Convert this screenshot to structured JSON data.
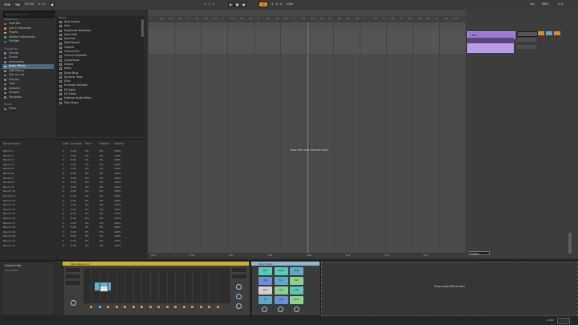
{
  "topbar": {
    "items": [
      "Link",
      "Tap",
      "Key",
      "MIDI"
    ],
    "bpm": "120.00",
    "signature": "4 / 4",
    "position": "1 . 1 . 1",
    "end": "4 . 0 . 0",
    "quantize": "1 Bar",
    "right_items": [
      "Key",
      "MIDI",
      "0 %"
    ]
  },
  "browser": {
    "search_placeholder": "Search (Cmd + F)",
    "collections_head": "Collections",
    "collections": [
      {
        "label": "Favorites",
        "color": "#d85050"
      },
      {
        "label": "Live 12 Recorded",
        "color": "#e08a30"
      },
      {
        "label": "Plugins",
        "color": "#d8c040"
      },
      {
        "label": "Ableton Instruments",
        "color": "#40b060"
      },
      {
        "label": "Untitled",
        "color": "#4080d0"
      }
    ],
    "categories_head": "Categories",
    "categories": [
      "Sounds",
      "Drums",
      "Instruments",
      "Audio Effects",
      "MIDI Effects",
      "Max for Live",
      "Plug-Ins",
      "Clips",
      "Samples",
      "Grooves",
      "Templates"
    ],
    "selected_category": "Audio Effects",
    "places_head": "Places",
    "places": [
      "Packs"
    ],
    "files_head": "Name",
    "files": [
      "Amp Analog",
      "Auto",
      "Amplitude Modulator",
      "Auto Filter",
      "Auto Pan",
      "Beat Repeat",
      "Cabinet",
      "Channel EQ",
      "Chorus-Ensemble",
      "Compressor",
      "Corpus",
      "Delay",
      "Drum Buss",
      "Dynamic Tube",
      "Echo",
      "Envelope Follower",
      "EQ Eight",
      "EQ Three",
      "External Audio Effect",
      "Filter Delay"
    ]
  },
  "rectable": {
    "headers": [
      "Record Name",
      "Slots",
      "Duration",
      "Pitch",
      "Position",
      "Velocity"
    ],
    "rows": [
      "Record 1",
      "Record 2",
      "Record 3",
      "Record 4",
      "Record 5",
      "Record 6",
      "Record 7",
      "Record 8",
      "Record 9",
      "Record 10",
      "Record 11",
      "Record 12",
      "Record 13",
      "Record 14",
      "Record 15",
      "Record 16",
      "Record 17",
      "Record 18",
      "Record 19",
      "Record 20",
      "Record 21",
      "Record 22"
    ],
    "cell_slots": "S",
    "cell_duration": "0:00",
    "cell_pitch": "0%",
    "cell_position": "0%",
    "cell_velocity": "100%"
  },
  "arrangement": {
    "ruler_ticks": [
      "1",
      "1.2",
      "1.3",
      "1.4",
      "2",
      "2.2",
      "2.3",
      "2.4",
      "3",
      "3.2",
      "3.3",
      "3.4",
      "4",
      "4.2",
      "4.3",
      "4.4",
      "5",
      "5.2",
      "5.3",
      "5.4",
      "6",
      "6.2",
      "6.3",
      "6.4",
      "7",
      "7.2",
      "7.3",
      "7.4",
      "8",
      "8.2",
      "8.3",
      "8.4",
      "9",
      "9.2",
      "9.3"
    ],
    "bottom_ticks": [
      "0:00",
      "0:02",
      "0:04",
      "0:06",
      "0:08",
      "0:10",
      "0:12",
      "0:14"
    ],
    "drop_hint": "Drop Files and Devices Here",
    "track_name": "1 MIDI",
    "master": "Master"
  },
  "devices": {
    "info_title": "Session Help",
    "info_sub": "Information",
    "step_seq_name": "Step Sequencer",
    "drum_rack_name": "Drum Rack",
    "pad_labels": [
      "Kick",
      "Snare",
      "Clap",
      "Hat",
      "Tom",
      "Rim",
      "Perc",
      "Cym",
      "Shk",
      "FX",
      "Crsh",
      "Ride"
    ],
    "drop_hint": "Drop Audio Effects Here"
  },
  "status": {
    "right_text": "1-MIDI"
  },
  "colors": {
    "accent": "#e28a2a",
    "track": "#9c7bd6",
    "selection": "#4d6a7a",
    "pad_blue": "#5fa8c8",
    "pad_teal": "#57c9b7",
    "pad_green": "#8fd18a"
  }
}
